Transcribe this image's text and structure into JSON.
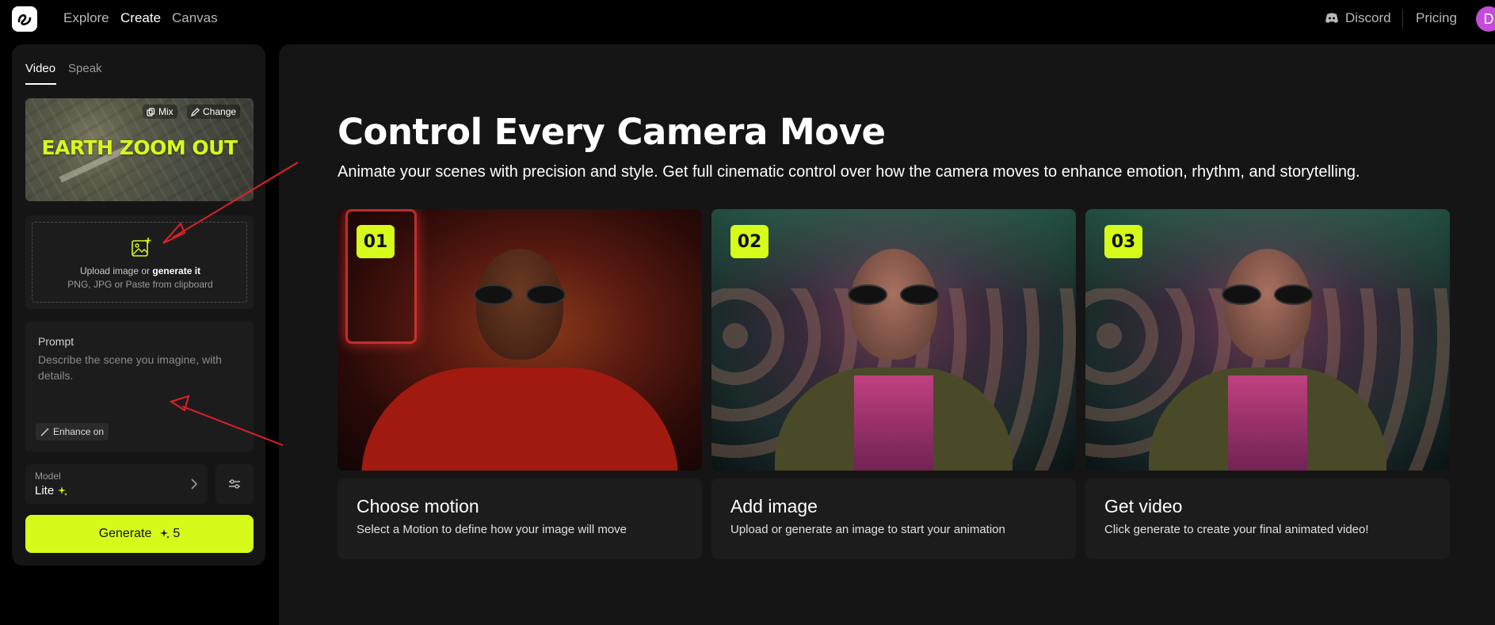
{
  "nav": {
    "links": [
      "Explore",
      "Create",
      "Canvas"
    ],
    "active": "Create",
    "discord": "Discord",
    "pricing": "Pricing",
    "avatar_initial": "D"
  },
  "panel": {
    "tabs": [
      "Video",
      "Speak"
    ],
    "active_tab": "Video",
    "preview": {
      "title": "EARTH ZOOM OUT",
      "mix_label": "Mix",
      "change_label": "Change"
    },
    "upload": {
      "text_prefix": "Upload image or",
      "text_link": "generate it",
      "formats": "PNG, JPG or Paste from clipboard"
    },
    "prompt": {
      "label": "Prompt",
      "placeholder": "Describe the scene you imagine, with details.",
      "enhance_label": "Enhance on"
    },
    "model": {
      "label": "Model",
      "value": "Lite"
    },
    "generate": {
      "label": "Generate",
      "cost": "5"
    }
  },
  "main": {
    "headline": "Control Every Camera Move",
    "subhead": "Animate your scenes with precision and style. Get full cinematic control over how the camera moves to enhance emotion, rhythm, and storytelling.",
    "steps": [
      {
        "badge": "01",
        "title": "Choose motion",
        "desc": "Select a Motion to define how your image will move"
      },
      {
        "badge": "02",
        "title": "Add image",
        "desc": "Upload or generate an image to start your animation"
      },
      {
        "badge": "03",
        "title": "Get video",
        "desc": "Click generate to create your final animated video!"
      }
    ]
  },
  "colors": {
    "accent": "#d6fb1a",
    "background": "#000000",
    "panel": "#151515",
    "annotation_arrow": "#e0202a"
  }
}
